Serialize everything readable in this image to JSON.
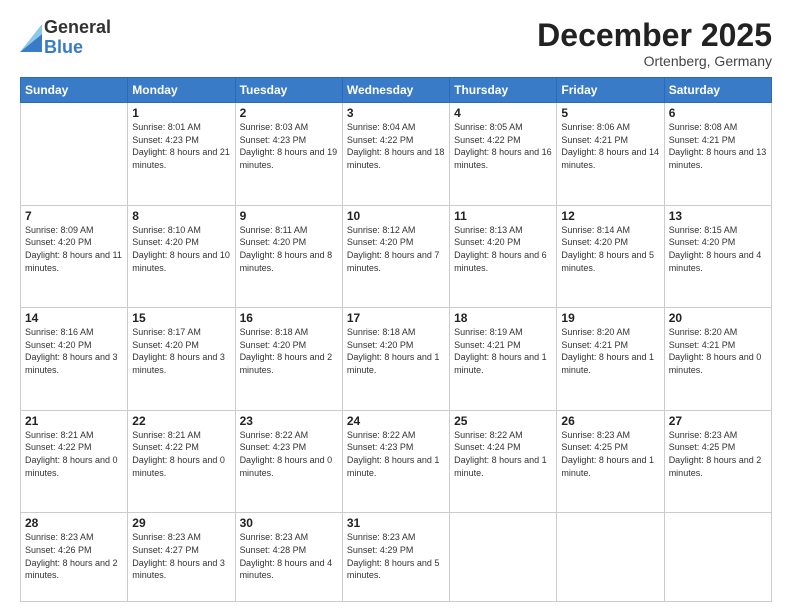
{
  "logo": {
    "general": "General",
    "blue": "Blue"
  },
  "header": {
    "title": "December 2025",
    "subtitle": "Ortenberg, Germany"
  },
  "days_of_week": [
    "Sunday",
    "Monday",
    "Tuesday",
    "Wednesday",
    "Thursday",
    "Friday",
    "Saturday"
  ],
  "weeks": [
    [
      {
        "day": "",
        "sunrise": "",
        "sunset": "",
        "daylight": ""
      },
      {
        "day": "1",
        "sunrise": "Sunrise: 8:01 AM",
        "sunset": "Sunset: 4:23 PM",
        "daylight": "Daylight: 8 hours and 21 minutes."
      },
      {
        "day": "2",
        "sunrise": "Sunrise: 8:03 AM",
        "sunset": "Sunset: 4:23 PM",
        "daylight": "Daylight: 8 hours and 19 minutes."
      },
      {
        "day": "3",
        "sunrise": "Sunrise: 8:04 AM",
        "sunset": "Sunset: 4:22 PM",
        "daylight": "Daylight: 8 hours and 18 minutes."
      },
      {
        "day": "4",
        "sunrise": "Sunrise: 8:05 AM",
        "sunset": "Sunset: 4:22 PM",
        "daylight": "Daylight: 8 hours and 16 minutes."
      },
      {
        "day": "5",
        "sunrise": "Sunrise: 8:06 AM",
        "sunset": "Sunset: 4:21 PM",
        "daylight": "Daylight: 8 hours and 14 minutes."
      },
      {
        "day": "6",
        "sunrise": "Sunrise: 8:08 AM",
        "sunset": "Sunset: 4:21 PM",
        "daylight": "Daylight: 8 hours and 13 minutes."
      }
    ],
    [
      {
        "day": "7",
        "sunrise": "Sunrise: 8:09 AM",
        "sunset": "Sunset: 4:20 PM",
        "daylight": "Daylight: 8 hours and 11 minutes."
      },
      {
        "day": "8",
        "sunrise": "Sunrise: 8:10 AM",
        "sunset": "Sunset: 4:20 PM",
        "daylight": "Daylight: 8 hours and 10 minutes."
      },
      {
        "day": "9",
        "sunrise": "Sunrise: 8:11 AM",
        "sunset": "Sunset: 4:20 PM",
        "daylight": "Daylight: 8 hours and 8 minutes."
      },
      {
        "day": "10",
        "sunrise": "Sunrise: 8:12 AM",
        "sunset": "Sunset: 4:20 PM",
        "daylight": "Daylight: 8 hours and 7 minutes."
      },
      {
        "day": "11",
        "sunrise": "Sunrise: 8:13 AM",
        "sunset": "Sunset: 4:20 PM",
        "daylight": "Daylight: 8 hours and 6 minutes."
      },
      {
        "day": "12",
        "sunrise": "Sunrise: 8:14 AM",
        "sunset": "Sunset: 4:20 PM",
        "daylight": "Daylight: 8 hours and 5 minutes."
      },
      {
        "day": "13",
        "sunrise": "Sunrise: 8:15 AM",
        "sunset": "Sunset: 4:20 PM",
        "daylight": "Daylight: 8 hours and 4 minutes."
      }
    ],
    [
      {
        "day": "14",
        "sunrise": "Sunrise: 8:16 AM",
        "sunset": "Sunset: 4:20 PM",
        "daylight": "Daylight: 8 hours and 3 minutes."
      },
      {
        "day": "15",
        "sunrise": "Sunrise: 8:17 AM",
        "sunset": "Sunset: 4:20 PM",
        "daylight": "Daylight: 8 hours and 3 minutes."
      },
      {
        "day": "16",
        "sunrise": "Sunrise: 8:18 AM",
        "sunset": "Sunset: 4:20 PM",
        "daylight": "Daylight: 8 hours and 2 minutes."
      },
      {
        "day": "17",
        "sunrise": "Sunrise: 8:18 AM",
        "sunset": "Sunset: 4:20 PM",
        "daylight": "Daylight: 8 hours and 1 minute."
      },
      {
        "day": "18",
        "sunrise": "Sunrise: 8:19 AM",
        "sunset": "Sunset: 4:21 PM",
        "daylight": "Daylight: 8 hours and 1 minute."
      },
      {
        "day": "19",
        "sunrise": "Sunrise: 8:20 AM",
        "sunset": "Sunset: 4:21 PM",
        "daylight": "Daylight: 8 hours and 1 minute."
      },
      {
        "day": "20",
        "sunrise": "Sunrise: 8:20 AM",
        "sunset": "Sunset: 4:21 PM",
        "daylight": "Daylight: 8 hours and 0 minutes."
      }
    ],
    [
      {
        "day": "21",
        "sunrise": "Sunrise: 8:21 AM",
        "sunset": "Sunset: 4:22 PM",
        "daylight": "Daylight: 8 hours and 0 minutes."
      },
      {
        "day": "22",
        "sunrise": "Sunrise: 8:21 AM",
        "sunset": "Sunset: 4:22 PM",
        "daylight": "Daylight: 8 hours and 0 minutes."
      },
      {
        "day": "23",
        "sunrise": "Sunrise: 8:22 AM",
        "sunset": "Sunset: 4:23 PM",
        "daylight": "Daylight: 8 hours and 0 minutes."
      },
      {
        "day": "24",
        "sunrise": "Sunrise: 8:22 AM",
        "sunset": "Sunset: 4:23 PM",
        "daylight": "Daylight: 8 hours and 1 minute."
      },
      {
        "day": "25",
        "sunrise": "Sunrise: 8:22 AM",
        "sunset": "Sunset: 4:24 PM",
        "daylight": "Daylight: 8 hours and 1 minute."
      },
      {
        "day": "26",
        "sunrise": "Sunrise: 8:23 AM",
        "sunset": "Sunset: 4:25 PM",
        "daylight": "Daylight: 8 hours and 1 minute."
      },
      {
        "day": "27",
        "sunrise": "Sunrise: 8:23 AM",
        "sunset": "Sunset: 4:25 PM",
        "daylight": "Daylight: 8 hours and 2 minutes."
      }
    ],
    [
      {
        "day": "28",
        "sunrise": "Sunrise: 8:23 AM",
        "sunset": "Sunset: 4:26 PM",
        "daylight": "Daylight: 8 hours and 2 minutes."
      },
      {
        "day": "29",
        "sunrise": "Sunrise: 8:23 AM",
        "sunset": "Sunset: 4:27 PM",
        "daylight": "Daylight: 8 hours and 3 minutes."
      },
      {
        "day": "30",
        "sunrise": "Sunrise: 8:23 AM",
        "sunset": "Sunset: 4:28 PM",
        "daylight": "Daylight: 8 hours and 4 minutes."
      },
      {
        "day": "31",
        "sunrise": "Sunrise: 8:23 AM",
        "sunset": "Sunset: 4:29 PM",
        "daylight": "Daylight: 8 hours and 5 minutes."
      },
      {
        "day": "",
        "sunrise": "",
        "sunset": "",
        "daylight": ""
      },
      {
        "day": "",
        "sunrise": "",
        "sunset": "",
        "daylight": ""
      },
      {
        "day": "",
        "sunrise": "",
        "sunset": "",
        "daylight": ""
      }
    ]
  ]
}
